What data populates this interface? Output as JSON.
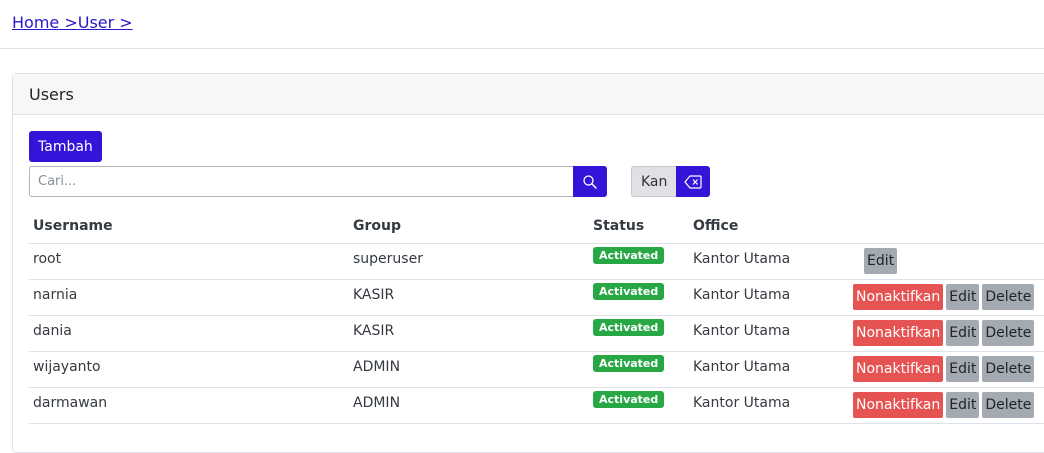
{
  "breadcrumb": {
    "home": "Home",
    "sep1": " >",
    "user": "User",
    "sep2": " >"
  },
  "card": {
    "title": "Users"
  },
  "toolbar": {
    "add_label": "Tambah",
    "search_placeholder": "Cari...",
    "filter_chip": "Kan"
  },
  "table": {
    "headers": {
      "username": "Username",
      "group": "Group",
      "status": "Status",
      "office": "Office"
    },
    "rows": [
      {
        "username": "root",
        "group": "superuser",
        "status": "Activated",
        "office": "Kantor Utama",
        "edit": "Edit"
      },
      {
        "username": "narnia",
        "group": "KASIR",
        "status": "Activated",
        "office": "Kantor Utama",
        "deactivate": "Nonaktifkan",
        "edit": "Edit",
        "delete": "Delete"
      },
      {
        "username": "dania",
        "group": "KASIR",
        "status": "Activated",
        "office": "Kantor Utama",
        "deactivate": "Nonaktifkan",
        "edit": "Edit",
        "delete": "Delete"
      },
      {
        "username": "wijayanto",
        "group": "ADMIN",
        "status": "Activated",
        "office": "Kantor Utama",
        "deactivate": "Nonaktifkan",
        "edit": "Edit",
        "delete": "Delete"
      },
      {
        "username": "darmawan",
        "group": "ADMIN",
        "status": "Activated",
        "office": "Kantor Utama",
        "deactivate": "Nonaktifkan",
        "edit": "Edit",
        "delete": "Delete"
      }
    ]
  },
  "colors": {
    "primary": "#3414d9",
    "danger": "#e55353",
    "success": "#28a745",
    "secondary": "#a4aab2"
  },
  "icons": {
    "search": "search-icon",
    "clear": "backspace-icon"
  }
}
